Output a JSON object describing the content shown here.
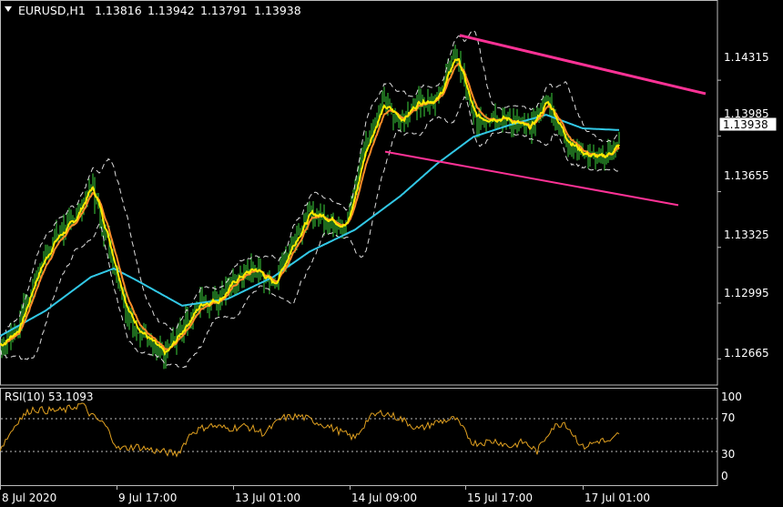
{
  "header": {
    "symbol": "EURUSD,H1",
    "open": "1.13816",
    "high": "1.13942",
    "low": "1.13791",
    "close": "1.13938"
  },
  "price_axis": {
    "ticks": [
      "1.14315",
      "1.13985",
      "1.13655",
      "1.13325",
      "1.12995",
      "1.12665"
    ],
    "current": "1.13938"
  },
  "rsi": {
    "label": "RSI(10) 53.1093",
    "ticks": [
      "100",
      "70",
      "30",
      "0"
    ],
    "levels": [
      70,
      30
    ]
  },
  "time_axis": {
    "ticks": [
      "8 Jul 2020",
      "9 Jul 17:00",
      "13 Jul 01:00",
      "14 Jul 09:00",
      "15 Jul 17:00",
      "17 Jul 01:00"
    ]
  },
  "colors": {
    "candles": "#3cd23c",
    "ma_fast": "#ffea00",
    "ma_mid": "#ff8c28",
    "ma_slow": "#32c8e6",
    "bollinger": "#dddddd",
    "trendline": "#ff3296",
    "rsi_line": "#e0a020",
    "axis": "#bbbbbb"
  },
  "chart_data": {
    "type": "line",
    "title": "EURUSD,H1",
    "ylim": [
      1.1251,
      1.1479
    ],
    "x_ticks": [
      "8 Jul 2020",
      "9 Jul 17:00",
      "13 Jul 01:00",
      "14 Jul 09:00",
      "15 Jul 17:00",
      "17 Jul 01:00"
    ],
    "series": [
      {
        "kind": "price",
        "x": [
          0,
          20,
          40,
          60,
          80,
          100,
          120,
          140,
          160,
          180,
          200,
          220,
          240,
          260,
          280,
          300,
          320,
          340,
          360,
          380,
          400,
          420,
          440,
          460,
          480,
          500,
          520,
          540,
          560,
          580,
          600,
          620,
          640,
          660,
          680
        ],
        "values": [
          1.1275,
          1.1285,
          1.1318,
          1.1338,
          1.1348,
          1.137,
          1.1332,
          1.1292,
          1.1279,
          1.1268,
          1.1285,
          1.13,
          1.1302,
          1.1315,
          1.132,
          1.131,
          1.1335,
          1.1353,
          1.135,
          1.1345,
          1.1392,
          1.1417,
          1.1408,
          1.142,
          1.142,
          1.1448,
          1.1408,
          1.141,
          1.1408,
          1.1402,
          1.142,
          1.1397,
          1.1388,
          1.1385,
          1.1394
        ]
      },
      {
        "kind": "ma_slow",
        "x": [
          0,
          50,
          100,
          125,
          150,
          200,
          250,
          300,
          340,
          390,
          440,
          480,
          520,
          560,
          600,
          640,
          680
        ],
        "values": [
          1.128,
          1.1295,
          1.1315,
          1.132,
          1.1313,
          1.1298,
          1.1302,
          1.1315,
          1.133,
          1.1343,
          1.1363,
          1.1382,
          1.1398,
          1.1405,
          1.1411,
          1.1403,
          1.1402
        ]
      },
      {
        "kind": "trendline_upper",
        "x": [
          505,
          775
        ],
        "values": [
          1.14581,
          1.14235
        ]
      },
      {
        "kind": "trendline_lower",
        "x": [
          423,
          745
        ],
        "values": [
          1.13892,
          1.13575
        ]
      },
      {
        "kind": "rsi",
        "x": [
          0,
          20,
          35,
          50,
          70,
          90,
          100,
          115,
          130,
          150,
          170,
          195,
          210,
          230,
          250,
          270,
          290,
          310,
          330,
          360,
          390,
          405,
          420,
          440,
          460,
          480,
          500,
          520,
          545,
          560,
          575,
          590,
          605,
          620,
          640,
          660,
          670,
          680
        ],
        "values": [
          33,
          68,
          82,
          80,
          80,
          88,
          74,
          63,
          33,
          36,
          31,
          27,
          53,
          62,
          58,
          61,
          52,
          71,
          73,
          61,
          46,
          71,
          78,
          70,
          57,
          66,
          70,
          40,
          43,
          36,
          42,
          30,
          58,
          66,
          35,
          44,
          40,
          53
        ]
      }
    ]
  }
}
